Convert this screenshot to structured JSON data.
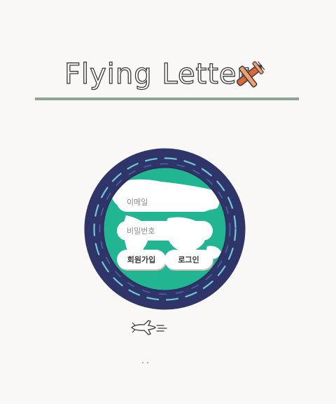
{
  "header": {
    "title": "Flying Letter",
    "logo_icon": "biplane-icon"
  },
  "login_form": {
    "email": {
      "placeholder": "이메일",
      "value": ""
    },
    "password": {
      "placeholder": "비밀번호",
      "value": ""
    },
    "signup_label": "회원가입",
    "login_label": "로그인"
  },
  "decorations": {
    "globe_icon": "earth-globe-icon",
    "small_plane_icon": "airplane-outline-icon"
  },
  "colors": {
    "background": "#f9f8f6",
    "divider": "#8fa595",
    "globe_ring": "#2f3568",
    "ocean": "#22b591",
    "land": "#ffffff",
    "biplane": "#d9683a"
  }
}
